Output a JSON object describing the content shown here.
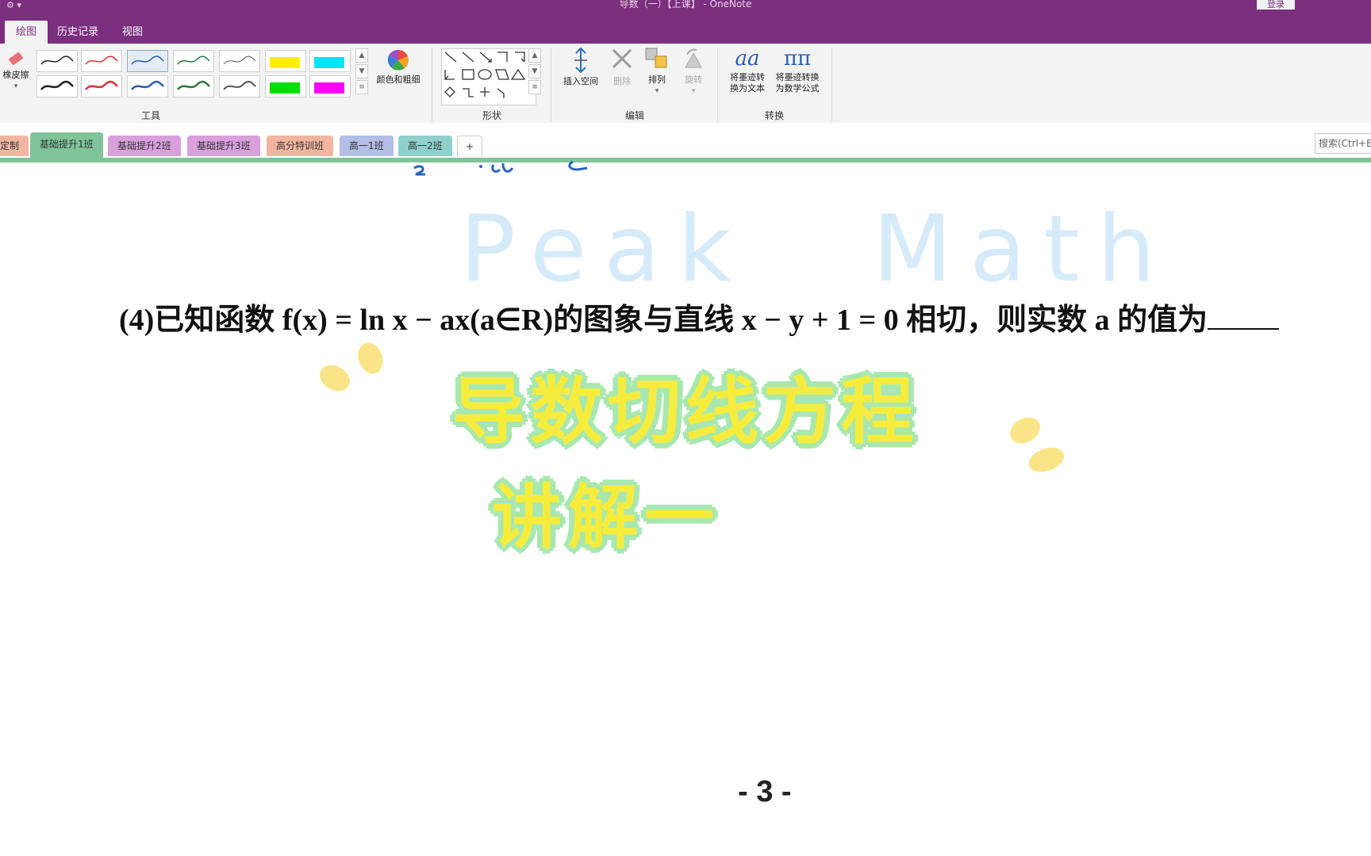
{
  "titlebar": {
    "title": "导数（一）【上课】 - OneNote",
    "login": "登录"
  },
  "tabs": [
    {
      "label": "绘图"
    },
    {
      "label": "历史记录"
    },
    {
      "label": "视图"
    }
  ],
  "ribbon": {
    "eraser": "橡皮擦",
    "color_thickness": "颜色和粗细",
    "group_tools": "工具",
    "group_shapes": "形状",
    "insert_space": "插入空间",
    "delete": "删除",
    "arrange": "排列",
    "rotate": "旋转",
    "group_edit": "编辑",
    "ink_to_text_1": "将墨迹转",
    "ink_to_text_2": "换为文本",
    "ink_to_math_1": "将墨迹转换",
    "ink_to_math_2": "为数学公式",
    "group_convert": "转换"
  },
  "sections": [
    {
      "label": "定制",
      "color": "#f2b6a0"
    },
    {
      "label": "基础提升1班",
      "color": "#7fc49a"
    },
    {
      "label": "基础提升2班",
      "color": "#d9a0dc"
    },
    {
      "label": "基础提升3班",
      "color": "#d9a0dc"
    },
    {
      "label": "高分特训班",
      "color": "#f2b6a0"
    },
    {
      "label": "高一1班",
      "color": "#b3bde6"
    },
    {
      "label": "高一2班",
      "color": "#8fd0cc"
    },
    {
      "label": "+",
      "color": "#ffffff"
    }
  ],
  "search": {
    "placeholder": "搜索(Ctrl+E)"
  },
  "page": {
    "watermark_1": "Peak",
    "watermark_2": "Math",
    "problem": "(4)已知函数 f(x) = ln x − ax(a∈R)的图象与直线 x − y + 1 = 0 相切，则实数 a 的值为",
    "banner_line1": "导数切线方程",
    "banner_line2": "讲解一",
    "page_number": "- 3 -"
  },
  "colors": {
    "brand": "#7b2f7e",
    "ribbon_bg": "#f3f3f3",
    "section_line": "#7fc49a"
  }
}
